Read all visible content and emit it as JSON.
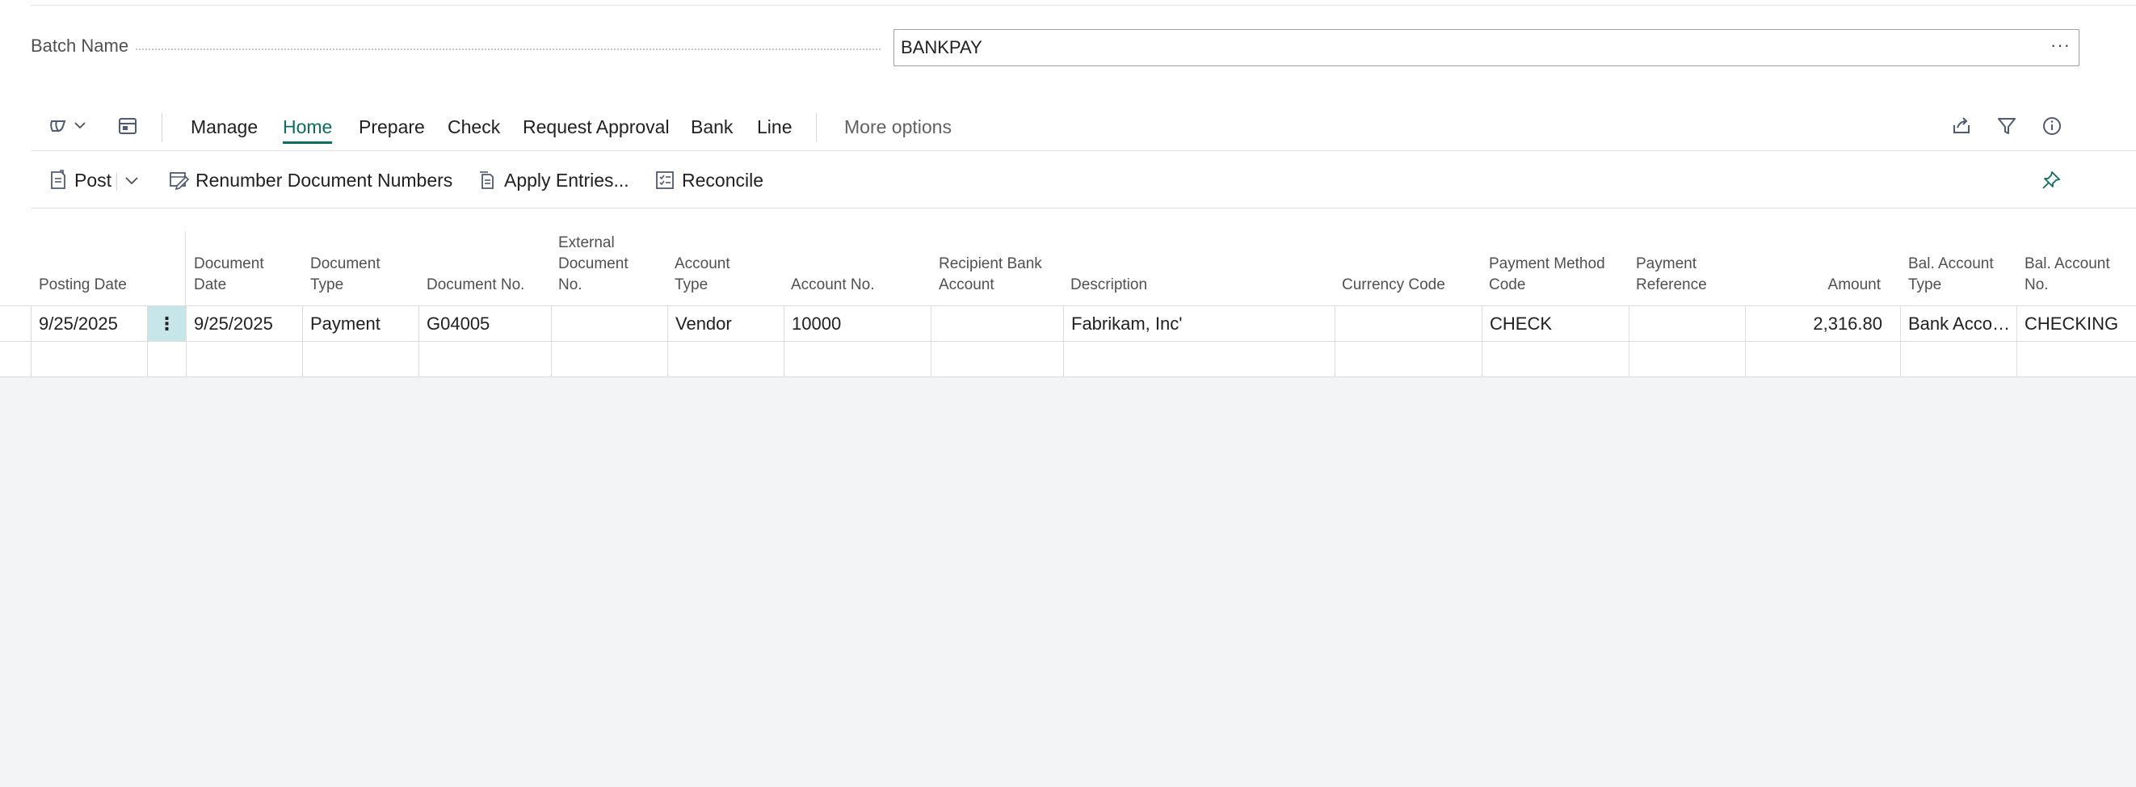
{
  "batch": {
    "label": "Batch Name",
    "value": "BANKPAY",
    "lookup_label": "···"
  },
  "tabs": {
    "manage": "Manage",
    "home": "Home",
    "prepare": "Prepare",
    "check": "Check",
    "request_approval": "Request Approval",
    "bank": "Bank",
    "line": "Line",
    "more_options": "More options"
  },
  "commands": {
    "post": "Post",
    "renumber": "Renumber Document Numbers",
    "apply_entries": "Apply Entries...",
    "reconcile": "Reconcile"
  },
  "columns": {
    "posting_date": "Posting Date",
    "document_date": "Document\nDate",
    "document_type": "Document\nType",
    "document_no": "Document No.",
    "external_document_no": "External\nDocument\nNo.",
    "account_type": "Account\nType",
    "account_no": "Account No.",
    "recipient_bank_account": "Recipient Bank\nAccount",
    "description": "Description",
    "currency_code": "Currency Code",
    "payment_method_code": "Payment Method\nCode",
    "payment_reference": "Payment\nReference",
    "amount": "Amount",
    "bal_account_type": "Bal. Account\nType",
    "bal_account_no": "Bal. Account\nNo."
  },
  "rows": [
    {
      "posting_date": "9/25/2025",
      "menu": "⋮",
      "document_date": "9/25/2025",
      "document_type": "Payment",
      "document_no": "G04005",
      "external_document_no": "",
      "account_type": "Vendor",
      "account_no": "10000",
      "recipient_bank_account": "",
      "description": "Fabrikam, Inc'",
      "currency_code": "",
      "payment_method_code": "CHECK",
      "payment_reference": "",
      "amount": "2,316.80",
      "bal_account_type": "Bank Account",
      "bal_account_no": "CHECKING"
    }
  ],
  "colors": {
    "accent": "#0f6c5e",
    "selected_cell": "#c7e6ea",
    "background": "#f3f4f5"
  },
  "icons": {
    "copilot": "copilot-icon",
    "chevron": "chevron-down-icon",
    "page_view": "page-layout-icon",
    "share": "share-icon",
    "filter": "filter-icon",
    "info": "info-icon",
    "pin": "pin-icon",
    "post": "post-icon",
    "renumber": "renumber-icon",
    "apply": "apply-entries-icon",
    "reconcile": "reconcile-icon"
  }
}
